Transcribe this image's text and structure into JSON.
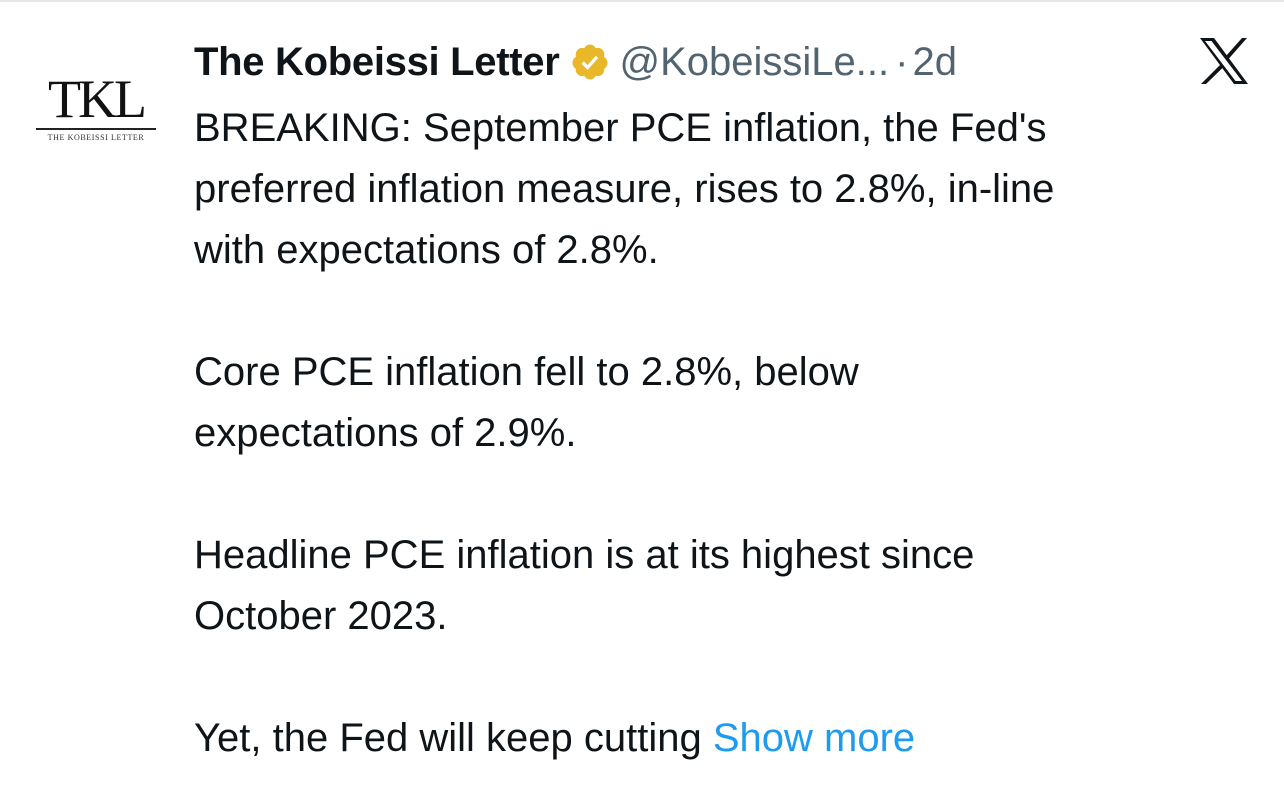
{
  "avatar": {
    "monogram": "TKL",
    "subtitle": "THE KOBEISSI LETTER"
  },
  "author": {
    "display_name": "The Kobeissi Letter",
    "handle": "@KobeissiLe...",
    "separator": "·",
    "age": "2d",
    "verified_icon": "verified-badge-icon",
    "verified_color": "#e8b829"
  },
  "platform_icon": "x-logo-icon",
  "tweet": {
    "p1_line1": "BREAKING: September PCE inflation, the Fed's",
    "p1_line2": "preferred inflation measure, rises to 2.8%, in-line",
    "p1_line3": "with expectations of 2.8%.",
    "p2_line1": "Core PCE inflation fell to 2.8%, below",
    "p2_line2": "expectations of 2.9%.",
    "p3_line1": "Headline PCE inflation is at its highest since",
    "p3_line2": "October 2023.",
    "p4_text": "Yet, the Fed will keep cutting ",
    "show_more": "Show more"
  },
  "colors": {
    "text": "#0f1419",
    "secondary": "#536471",
    "link": "#1d9bf0"
  }
}
